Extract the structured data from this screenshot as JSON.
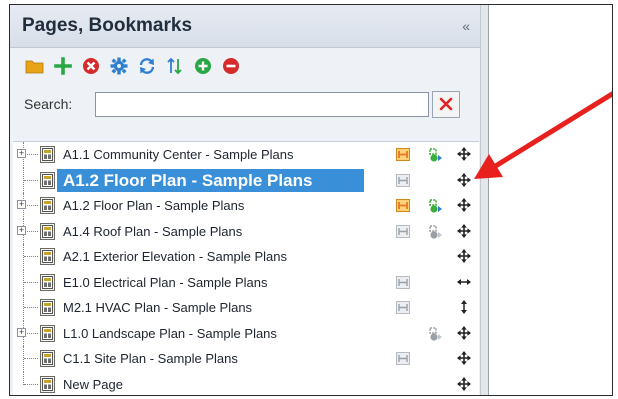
{
  "panel": {
    "title": "Pages, Bookmarks",
    "collapse_label": "«"
  },
  "toolbar": {
    "buttons": [
      {
        "icon": "folder-icon",
        "color": "#e8a317"
      },
      {
        "icon": "add-icon",
        "color": "#27a844"
      },
      {
        "icon": "delete-icon",
        "color": "#d62b2b"
      },
      {
        "icon": "settings-icon",
        "color": "#2f7fd0"
      },
      {
        "icon": "refresh-icon",
        "color": "#2f7fd0"
      },
      {
        "icon": "sort-icon",
        "color": "#2f7fd0"
      },
      {
        "icon": "expand-all-icon",
        "color": "#27a844"
      },
      {
        "icon": "collapse-all-icon",
        "color": "#d62b2b"
      }
    ]
  },
  "search": {
    "label": "Search:",
    "value": "",
    "placeholder": ""
  },
  "pages": [
    {
      "label": "A1.1 Community Center - Sample Plans",
      "expandable": true,
      "expander": "+",
      "selected": false,
      "hyperlink": "active",
      "markups": true,
      "move": "all"
    },
    {
      "label": "A1.2 Floor Plan - Sample Plans",
      "expandable": false,
      "expander": "",
      "selected": true,
      "hyperlink": "inactive",
      "markups": false,
      "move": "all"
    },
    {
      "label": "A1.2 Floor Plan - Sample Plans",
      "expandable": true,
      "expander": "+",
      "selected": false,
      "hyperlink": "active",
      "markups": true,
      "move": "all"
    },
    {
      "label": "A1.4 Roof Plan - Sample Plans",
      "expandable": true,
      "expander": "+",
      "selected": false,
      "hyperlink": "inactive",
      "markups": "grey",
      "move": "all"
    },
    {
      "label": "A2.1 Exterior Elevation - Sample Plans",
      "expandable": false,
      "expander": "",
      "selected": false,
      "hyperlink": "none",
      "markups": false,
      "move": "all"
    },
    {
      "label": "E1.0 Electrical Plan - Sample Plans",
      "expandable": false,
      "expander": "",
      "selected": false,
      "hyperlink": "inactive",
      "markups": false,
      "move": "horizontal"
    },
    {
      "label": "M2.1 HVAC Plan - Sample Plans",
      "expandable": false,
      "expander": "",
      "selected": false,
      "hyperlink": "inactive",
      "markups": false,
      "move": "vertical"
    },
    {
      "label": "L1.0 Landscape Plan - Sample Plans",
      "expandable": true,
      "expander": "+",
      "selected": false,
      "hyperlink": "none",
      "markups": "grey",
      "move": "all"
    },
    {
      "label": "C1.1 Site Plan - Sample Plans",
      "expandable": false,
      "expander": "",
      "selected": false,
      "hyperlink": "inactive",
      "markups": false,
      "move": "all"
    },
    {
      "label": "New Page",
      "expandable": false,
      "expander": "",
      "selected": false,
      "hyperlink": "none",
      "markups": false,
      "move": "all"
    }
  ],
  "colors": {
    "selection": "#3a8fd9",
    "hyperlink_active": "#e87722",
    "hyperlink_inactive": "#9aa0a8",
    "markups_active": "#3cae3a",
    "markups_grey": "#9a9ea5",
    "callout_arrow": "#e8201e"
  }
}
